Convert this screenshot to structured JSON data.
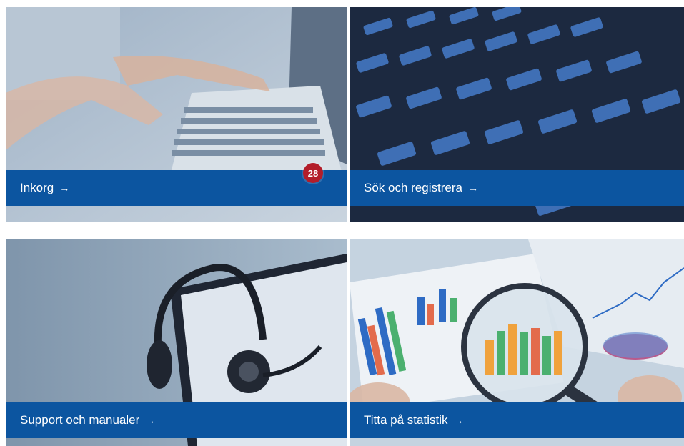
{
  "tiles": [
    {
      "id": "inbox",
      "label": "Inkorg",
      "arrow": "→",
      "badge": "28",
      "image": "laptop-typing"
    },
    {
      "id": "search",
      "label": "Sök och registrera",
      "arrow": "→",
      "image": "keyboard-closeup"
    },
    {
      "id": "support",
      "label": "Support och manualer",
      "arrow": "→",
      "image": "headset-tablet"
    },
    {
      "id": "stats",
      "label": "Titta på statistik",
      "arrow": "→",
      "image": "magnifier-charts"
    }
  ],
  "colors": {
    "banner": "#0c55a0",
    "badge": "#b31d2a"
  }
}
